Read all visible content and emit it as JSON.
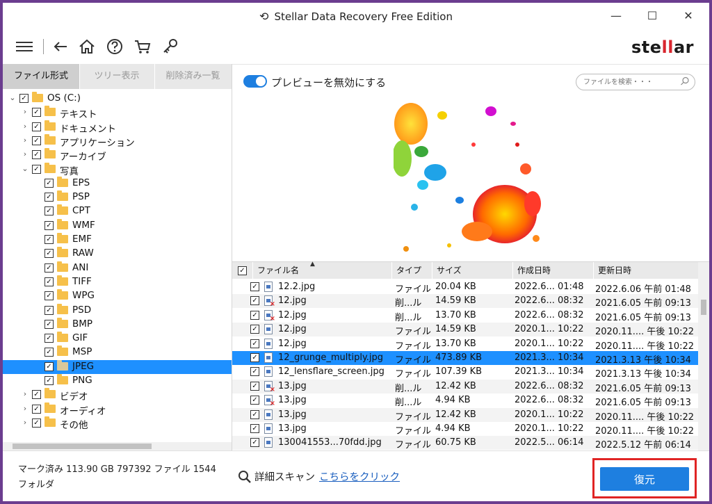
{
  "window": {
    "title": "Stellar Data Recovery Free Edition"
  },
  "brand": {
    "logo_prefix": "ste",
    "logo_bars": "ll",
    "logo_suffix": "ar"
  },
  "tabs": [
    {
      "label": "ファイル形式",
      "active": true
    },
    {
      "label": "ツリー表示",
      "active": false
    },
    {
      "label": "削除済み一覧",
      "active": false
    }
  ],
  "tree": [
    {
      "label": "OS (C:)",
      "level": 0,
      "expanded": true,
      "checked": true,
      "selected": false
    },
    {
      "label": "テキスト",
      "level": 1,
      "expanded": false,
      "checked": true,
      "selected": false
    },
    {
      "label": "ドキュメント",
      "level": 1,
      "expanded": false,
      "checked": true,
      "selected": false
    },
    {
      "label": "アプリケーション",
      "level": 1,
      "expanded": false,
      "checked": true,
      "selected": false
    },
    {
      "label": "アーカイブ",
      "level": 1,
      "expanded": false,
      "checked": true,
      "selected": false
    },
    {
      "label": "写真",
      "level": 1,
      "expanded": true,
      "checked": true,
      "selected": false
    },
    {
      "label": "EPS",
      "level": 2,
      "checked": true,
      "selected": false
    },
    {
      "label": "PSP",
      "level": 2,
      "checked": true,
      "selected": false
    },
    {
      "label": "CPT",
      "level": 2,
      "checked": true,
      "selected": false
    },
    {
      "label": "WMF",
      "level": 2,
      "checked": true,
      "selected": false
    },
    {
      "label": "EMF",
      "level": 2,
      "checked": true,
      "selected": false
    },
    {
      "label": "RAW",
      "level": 2,
      "checked": true,
      "selected": false
    },
    {
      "label": "ANI",
      "level": 2,
      "checked": true,
      "selected": false
    },
    {
      "label": "TIFF",
      "level": 2,
      "checked": true,
      "selected": false
    },
    {
      "label": "WPG",
      "level": 2,
      "checked": true,
      "selected": false
    },
    {
      "label": "PSD",
      "level": 2,
      "checked": true,
      "selected": false
    },
    {
      "label": "BMP",
      "level": 2,
      "checked": true,
      "selected": false
    },
    {
      "label": "GIF",
      "level": 2,
      "checked": true,
      "selected": false
    },
    {
      "label": "MSP",
      "level": 2,
      "checked": true,
      "selected": false
    },
    {
      "label": "JPEG",
      "level": 2,
      "checked": true,
      "selected": true
    },
    {
      "label": "PNG",
      "level": 2,
      "checked": true,
      "selected": false
    },
    {
      "label": "ビデオ",
      "level": 1,
      "expanded": false,
      "checked": true,
      "selected": false
    },
    {
      "label": "オーディオ",
      "level": 1,
      "expanded": false,
      "checked": true,
      "selected": false
    },
    {
      "label": "その他",
      "level": 1,
      "expanded": false,
      "checked": true,
      "selected": false
    }
  ],
  "preview": {
    "toggle_label": "プレビューを無効にする",
    "toggle_on": true
  },
  "search": {
    "placeholder": "ファイルを検索・・・"
  },
  "table": {
    "columns": [
      "ファイル名",
      "タイプ",
      "サイズ",
      "作成日時",
      "更新日時"
    ],
    "rows": [
      {
        "name": "12.2.jpg",
        "type": "ファイル",
        "size": "20.04 KB",
        "created": "2022.6... 01:48",
        "modified": "2022.6.06 午前 01:48",
        "deleted": false,
        "selected": false
      },
      {
        "name": "12.jpg",
        "type": "削...ル",
        "size": "14.59 KB",
        "created": "2022.6... 08:32",
        "modified": "2021.6.05 午前 09:13",
        "deleted": true,
        "selected": false
      },
      {
        "name": "12.jpg",
        "type": "削...ル",
        "size": "13.70 KB",
        "created": "2022.6... 08:32",
        "modified": "2021.6.05 午前 09:13",
        "deleted": true,
        "selected": false
      },
      {
        "name": "12.jpg",
        "type": "ファイル",
        "size": "14.59 KB",
        "created": "2020.1... 10:22",
        "modified": "2020.11.... 午後 10:22",
        "deleted": false,
        "selected": false
      },
      {
        "name": "12.jpg",
        "type": "ファイル",
        "size": "13.70 KB",
        "created": "2020.1... 10:22",
        "modified": "2020.11.... 午後 10:22",
        "deleted": false,
        "selected": false
      },
      {
        "name": "12_grunge_multiply.jpg",
        "type": "ファイル",
        "size": "473.89 KB",
        "created": "2021.3... 10:34",
        "modified": "2021.3.13 午後 10:34",
        "deleted": false,
        "selected": true
      },
      {
        "name": "12_lensflare_screen.jpg",
        "type": "ファイル",
        "size": "107.39 KB",
        "created": "2021.3... 10:34",
        "modified": "2021.3.13 午後 10:34",
        "deleted": false,
        "selected": false
      },
      {
        "name": "13.jpg",
        "type": "削...ル",
        "size": "12.42 KB",
        "created": "2022.6... 08:32",
        "modified": "2021.6.05 午前 09:13",
        "deleted": true,
        "selected": false
      },
      {
        "name": "13.jpg",
        "type": "削...ル",
        "size": "4.94 KB",
        "created": "2022.6... 08:32",
        "modified": "2021.6.05 午前 09:13",
        "deleted": true,
        "selected": false
      },
      {
        "name": "13.jpg",
        "type": "ファイル",
        "size": "12.42 KB",
        "created": "2020.1... 10:22",
        "modified": "2020.11.... 午後 10:22",
        "deleted": false,
        "selected": false
      },
      {
        "name": "13.jpg",
        "type": "ファイル",
        "size": "4.94 KB",
        "created": "2020.1... 10:22",
        "modified": "2020.11.... 午後 10:22",
        "deleted": false,
        "selected": false
      },
      {
        "name": "130041553...70fdd.jpg",
        "type": "ファイル",
        "size": "60.75 KB",
        "created": "2022.5... 06:14",
        "modified": "2022.5.12 午前 06:14",
        "deleted": false,
        "selected": false
      }
    ]
  },
  "footer": {
    "status": "マーク済み 113.90 GB 797392 ファイル 1544 フォルダ",
    "deep_scan_label": "詳細スキャン",
    "deep_scan_link": "こちらをクリック",
    "recover_label": "復元"
  },
  "colors": {
    "accent": "#1e7fe0",
    "selection": "#1e90ff",
    "highlight_frame": "#e02424",
    "logo_bars": "#d8262e"
  }
}
